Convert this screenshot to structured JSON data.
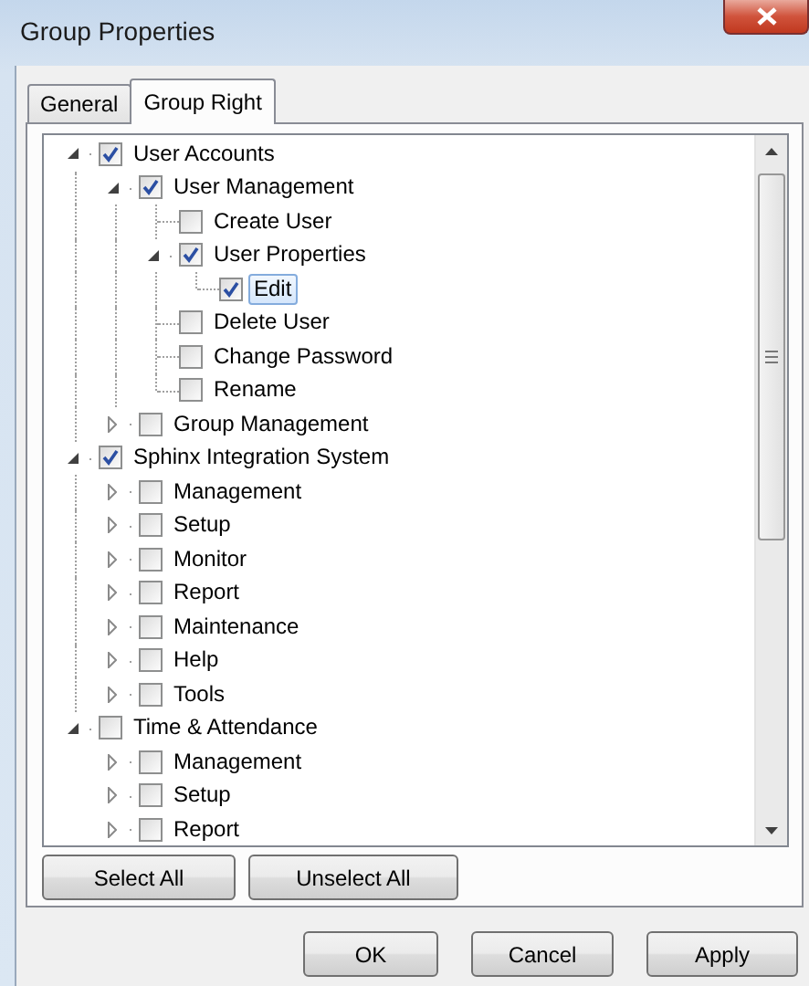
{
  "window": {
    "title": "Group Properties"
  },
  "tabs": [
    {
      "label": "General",
      "selected": false
    },
    {
      "label": "Group Right",
      "selected": true
    }
  ],
  "tree": [
    {
      "label": "User Accounts",
      "kind": "branch",
      "expanded": true,
      "checked": true,
      "selected": false,
      "children": [
        {
          "label": "User Management",
          "kind": "branch",
          "expanded": true,
          "checked": true,
          "selected": false,
          "children": [
            {
              "label": "Create User",
              "kind": "leaf",
              "checked": false,
              "selected": false
            },
            {
              "label": "User Properties",
              "kind": "branch",
              "expanded": true,
              "checked": true,
              "selected": false,
              "children": [
                {
                  "label": "Edit",
                  "kind": "leaf",
                  "checked": true,
                  "selected": true
                }
              ]
            },
            {
              "label": "Delete User",
              "kind": "leaf",
              "checked": false,
              "selected": false
            },
            {
              "label": "Change Password",
              "kind": "leaf",
              "checked": false,
              "selected": false
            },
            {
              "label": "Rename",
              "kind": "leaf",
              "checked": false,
              "selected": false
            }
          ]
        },
        {
          "label": "Group Management",
          "kind": "branch",
          "expanded": false,
          "checked": false,
          "selected": false
        }
      ]
    },
    {
      "label": "Sphinx Integration System",
      "kind": "branch",
      "expanded": true,
      "checked": true,
      "selected": false,
      "children": [
        {
          "label": "Management",
          "kind": "branch",
          "expanded": false,
          "checked": false,
          "selected": false
        },
        {
          "label": "Setup",
          "kind": "branch",
          "expanded": false,
          "checked": false,
          "selected": false
        },
        {
          "label": "Monitor",
          "kind": "branch",
          "expanded": false,
          "checked": false,
          "selected": false
        },
        {
          "label": "Report",
          "kind": "branch",
          "expanded": false,
          "checked": false,
          "selected": false
        },
        {
          "label": "Maintenance",
          "kind": "branch",
          "expanded": false,
          "checked": false,
          "selected": false
        },
        {
          "label": "Help",
          "kind": "branch",
          "expanded": false,
          "checked": false,
          "selected": false
        },
        {
          "label": "Tools",
          "kind": "branch",
          "expanded": false,
          "checked": false,
          "selected": false
        }
      ]
    },
    {
      "label": "Time & Attendance",
      "kind": "branch",
      "expanded": true,
      "checked": false,
      "selected": false,
      "children": [
        {
          "label": "Management",
          "kind": "branch",
          "expanded": false,
          "checked": false,
          "selected": false
        },
        {
          "label": "Setup",
          "kind": "branch",
          "expanded": false,
          "checked": false,
          "selected": false
        },
        {
          "label": "Report",
          "kind": "branch",
          "expanded": false,
          "checked": false,
          "selected": false
        }
      ]
    }
  ],
  "tree_buttons": [
    "Select All",
    "Unselect All"
  ],
  "buttons": [
    "OK",
    "Cancel",
    "Apply"
  ]
}
